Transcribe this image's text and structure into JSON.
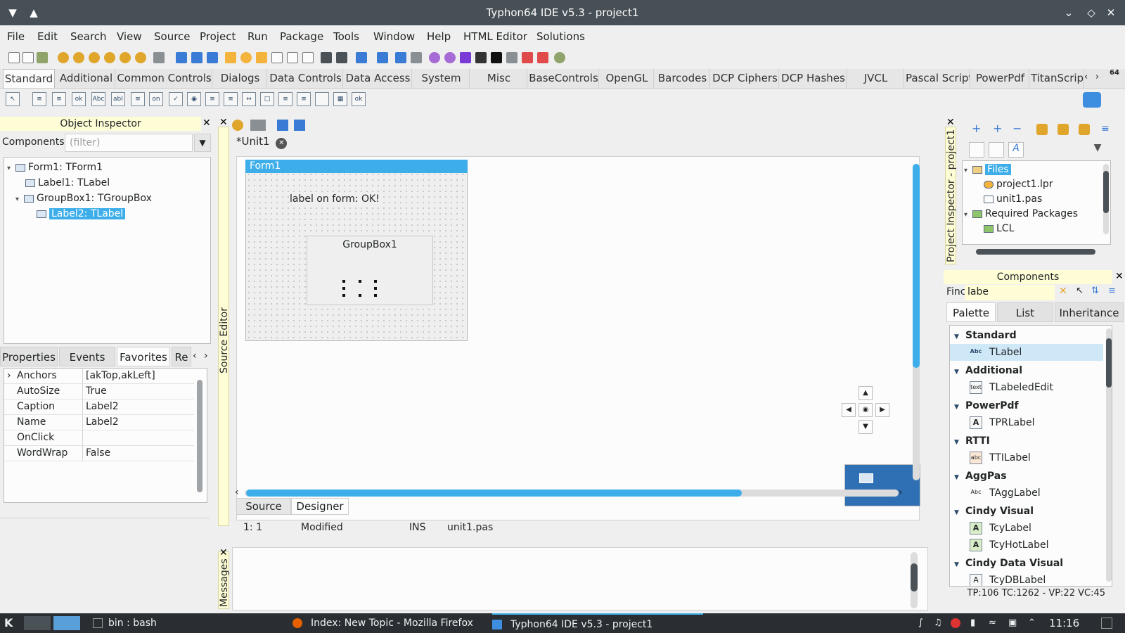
{
  "window": {
    "title": "Typhon64 IDE v5.3 - project1"
  },
  "menu": [
    "File",
    "Edit",
    "Search",
    "View",
    "Source",
    "Project",
    "Run",
    "Package",
    "Tools",
    "Window",
    "Help",
    "HTML Editor",
    "Solutions"
  ],
  "palette_tabs": [
    "Standard",
    "Additional",
    "Common Controls",
    "Dialogs",
    "Data Controls",
    "Data Access",
    "System",
    "Misc",
    "BaseControls",
    "OpenGL",
    "Barcodes",
    "DCP Ciphers",
    "DCP Hashes",
    "JVCL",
    "Pascal Script",
    "PowerPdf",
    "TitanScrip"
  ],
  "palette_badge": "64",
  "object_inspector": {
    "title": "Object Inspector",
    "components_label": "Components",
    "filter_placeholder": "(filter)",
    "tree": [
      {
        "label": "Form1: TForm1"
      },
      {
        "label": "Label1: TLabel"
      },
      {
        "label": "GroupBox1: TGroupBox"
      },
      {
        "label": "Label2: TLabel"
      }
    ],
    "tabs": [
      "Properties",
      "Events",
      "Favorites",
      "Re"
    ],
    "properties": [
      {
        "name": "Anchors",
        "value": "[akTop,akLeft]"
      },
      {
        "name": "AutoSize",
        "value": "True"
      },
      {
        "name": "Caption",
        "value": "Label2"
      },
      {
        "name": "Name",
        "value": "Label2"
      },
      {
        "name": "OnClick",
        "value": ""
      },
      {
        "name": "WordWrap",
        "value": "False"
      }
    ]
  },
  "side_labels": {
    "source_editor": "Source Editor",
    "messages": "Messages",
    "project_inspector": "Project Inspector - project1"
  },
  "editor": {
    "tab": "*Unit1",
    "form_caption": "Form1",
    "label_text": "label on form: OK!",
    "groupbox_caption": "GroupBox1",
    "bottom_tabs": [
      "Source",
      "Designer"
    ],
    "status": {
      "pos": "1:  1",
      "modified": "Modified",
      "mode": "INS",
      "file": "unit1.pas"
    }
  },
  "project_inspector": {
    "tree": [
      {
        "label": "Files"
      },
      {
        "label": "project1.lpr"
      },
      {
        "label": "unit1.pas"
      },
      {
        "label": "Required Packages"
      },
      {
        "label": "LCL"
      }
    ]
  },
  "components": {
    "title": "Components",
    "find_label": "Finc",
    "find_value": "labe",
    "tabs": [
      "Palette",
      "List",
      "Inheritance"
    ],
    "groups": [
      {
        "name": "Standard",
        "items": [
          {
            "label": "TLabel",
            "icon": "Abc"
          }
        ]
      },
      {
        "name": "Additional",
        "items": [
          {
            "label": "TLabeledEdit",
            "icon": "text"
          }
        ]
      },
      {
        "name": "PowerPdf",
        "items": [
          {
            "label": "TPRLabel",
            "icon": "A"
          }
        ]
      },
      {
        "name": "RTTI",
        "items": [
          {
            "label": "TTILabel",
            "icon": "abc"
          }
        ]
      },
      {
        "name": "AggPas",
        "items": [
          {
            "label": "TAggLabel",
            "icon": "Abc"
          }
        ]
      },
      {
        "name": "Cindy Visual",
        "items": [
          {
            "label": "TcyLabel",
            "icon": "A"
          },
          {
            "label": "TcyHotLabel",
            "icon": "A"
          }
        ]
      },
      {
        "name": "Cindy Data Visual",
        "items": [
          {
            "label": "TcyDBLabel",
            "icon": "A"
          }
        ]
      }
    ],
    "status": "TP:106 TC:1262 - VP:22 VC:45"
  },
  "taskbar": {
    "items": [
      "bin : bash",
      "Index: New Topic - Mozilla Firefox",
      "Typhon64 IDE v5.3 - project1"
    ],
    "clock": "11:16"
  },
  "colors": {
    "accent": "#3daee9",
    "titlebar": "#475057",
    "hint_yellow": "#fffdd6",
    "taskbar": "#2a2e32"
  }
}
